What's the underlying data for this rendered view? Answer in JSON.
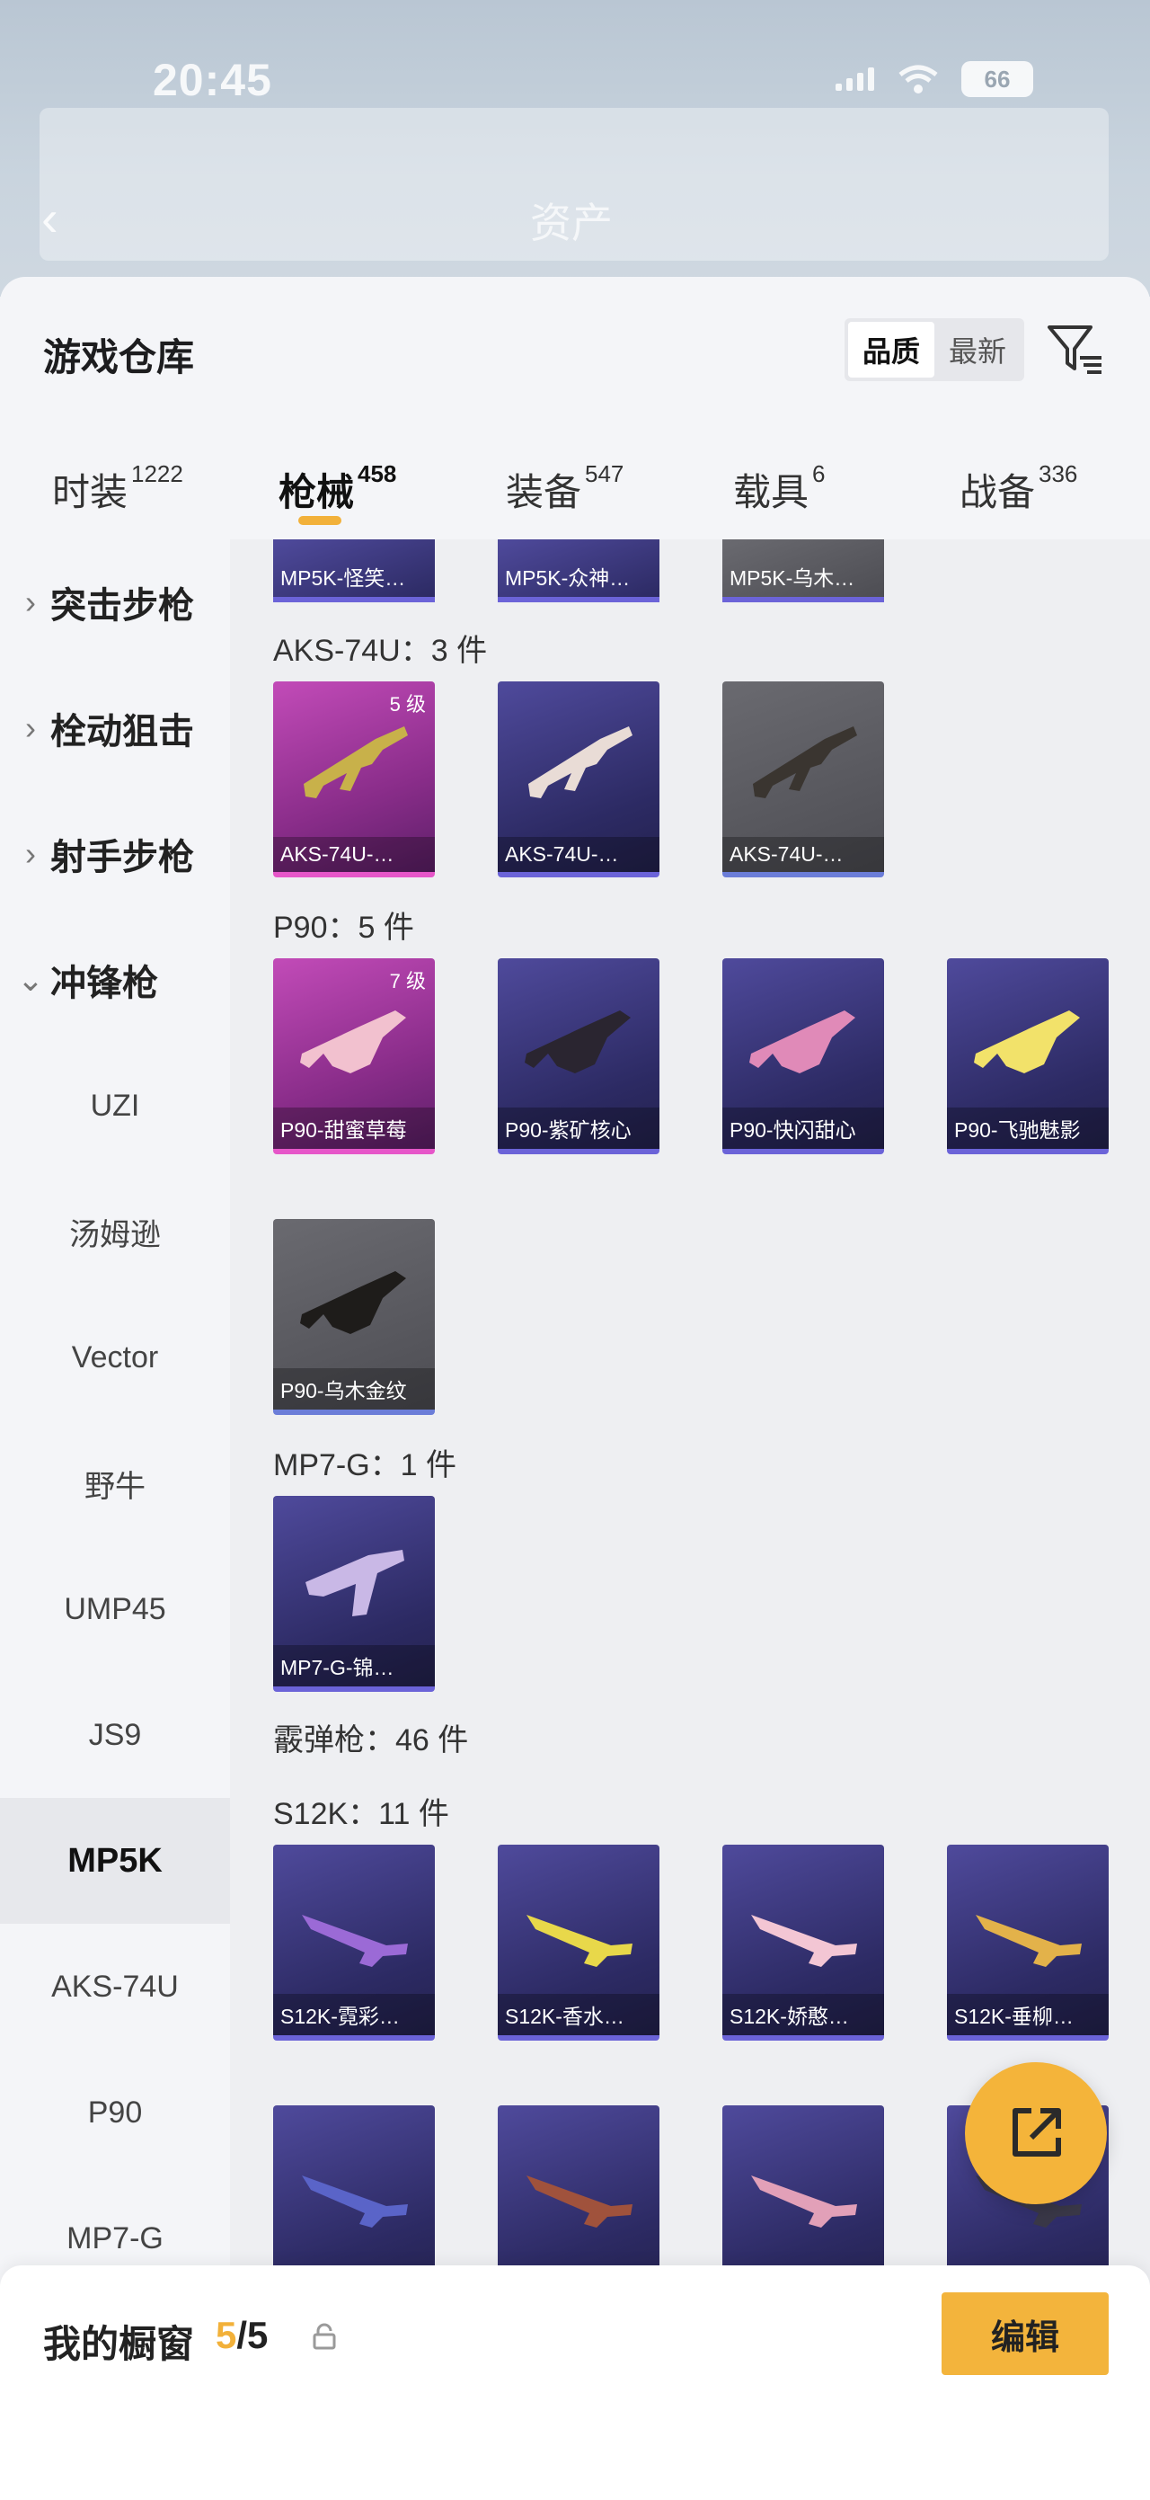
{
  "status": {
    "time": "20:45",
    "battery": "66"
  },
  "background": {
    "back_glyph": "‹",
    "title": "资产"
  },
  "sheet": {
    "title": "游戏仓库",
    "sort": [
      "品质",
      "最新"
    ],
    "sort_active": "品质"
  },
  "tabs": [
    {
      "label": "时装",
      "count": "1222"
    },
    {
      "label": "枪械",
      "count": "458"
    },
    {
      "label": "装备",
      "count": "547"
    },
    {
      "label": "载具",
      "count": "6"
    },
    {
      "label": "战备",
      "count": "336"
    }
  ],
  "sidebar": {
    "categories": [
      {
        "label": "突击步枪",
        "chevron": "›"
      },
      {
        "label": "栓动狙击",
        "chevron": "›"
      },
      {
        "label": "射手步枪",
        "chevron": "›"
      },
      {
        "label": "冲锋枪",
        "chevron": "⌄"
      }
    ],
    "subs": [
      "UZI",
      "汤姆逊",
      "Vector",
      "野牛",
      "UMP45",
      "JS9",
      "MP5K",
      "AKS-74U",
      "P90",
      "MP7-G"
    ],
    "active_sub": "MP5K"
  },
  "content": {
    "top_row": [
      "MP5K-怪笑…",
      "MP5K-众神…",
      "MP5K-乌木…"
    ],
    "sections": [
      {
        "title": "AKS-74U：3 件",
        "items": [
          {
            "name": "AKS-74U-…",
            "level": "5 级",
            "rarity": "pink"
          },
          {
            "name": "AKS-74U-…",
            "level": "",
            "rarity": "purple"
          },
          {
            "name": "AKS-74U-…",
            "level": "",
            "rarity": "gray"
          }
        ]
      },
      {
        "title": "P90：5 件",
        "items": [
          {
            "name": "P90-甜蜜草莓",
            "level": "7 级",
            "rarity": "pink"
          },
          {
            "name": "P90-紫矿核心",
            "level": "",
            "rarity": "purple"
          },
          {
            "name": "P90-快闪甜心",
            "level": "",
            "rarity": "purple"
          },
          {
            "name": "P90-飞驰魅影",
            "level": "",
            "rarity": "purple"
          },
          {
            "name": "P90-乌木金纹",
            "level": "",
            "rarity": "gray"
          }
        ]
      },
      {
        "title": "MP7-G：1 件",
        "items": [
          {
            "name": "MP7-G-锦…",
            "level": "",
            "rarity": "purple"
          }
        ]
      }
    ],
    "shotgun_title": "霰弹枪：46 件",
    "s12k_title": "S12K：11 件",
    "s12k_items": [
      "S12K-霓彩…",
      "S12K-香水…",
      "S12K-娇憨…",
      "S12K-垂柳…"
    ]
  },
  "showcase": {
    "title": "我的橱窗",
    "current": "5",
    "total": "/5",
    "edit_label": "编辑"
  },
  "colors": {
    "accent": "#f2b13a",
    "purple": "#6b63d8",
    "pink": "#e656c9"
  }
}
